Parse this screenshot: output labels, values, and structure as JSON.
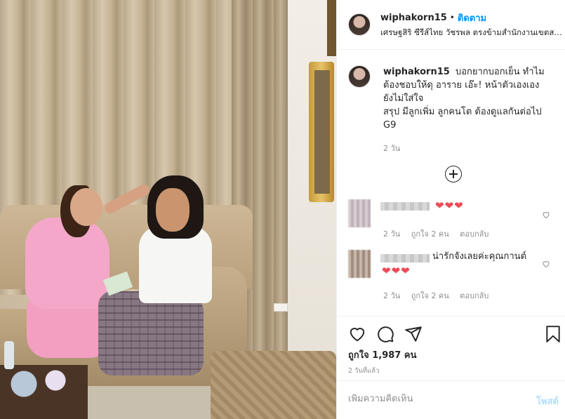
{
  "post": {
    "username": "wiphakorn15",
    "separator": "•",
    "follow_label": "ติดตาม",
    "location": "เศรษฐสิริ ซีรีส์ไทย วัชรพล ตรงข้ามสำนักงานเขตสายไหม"
  },
  "caption": {
    "username": "wiphakorn15",
    "lines": [
      "บอกยากบอกเย็น ทำไม",
      "ต้องชอบให้ดุ อาราย เอ๊ะ! หน้าตัวเองเอง",
      "ยังไม่ใส่ใจ",
      "สรุป มีลูกเพิ่ม ลูกคนโต ต้องดูแลกันต่อไป",
      "G9"
    ],
    "time": "2 วัน"
  },
  "comments": [
    {
      "text": "❤❤❤",
      "time": "2 วัน",
      "likes": "ถูกใจ 2 คน",
      "reply": "ตอบกลับ"
    },
    {
      "text": "น่ารักจังเลยค่ะคุณกานต์",
      "hearts": "❤❤❤",
      "time": "2 วัน",
      "likes": "ถูกใจ 2 คน",
      "reply": "ตอบกลับ"
    }
  ],
  "actions": {
    "likes_count": "ถูกใจ 1,987 คน",
    "date": "2 วันที่แล้ว",
    "icons": [
      "heart-icon",
      "comment-icon",
      "share-icon",
      "bookmark-icon"
    ]
  },
  "add_comment": {
    "placeholder": "เพิ่มความคิดเห็น",
    "post_label": "โพสต์"
  },
  "colors": {
    "accent": "#0095f6",
    "heart": "#ed4956",
    "muted": "#8e8e8e",
    "post_disabled": "#b2dffc"
  }
}
